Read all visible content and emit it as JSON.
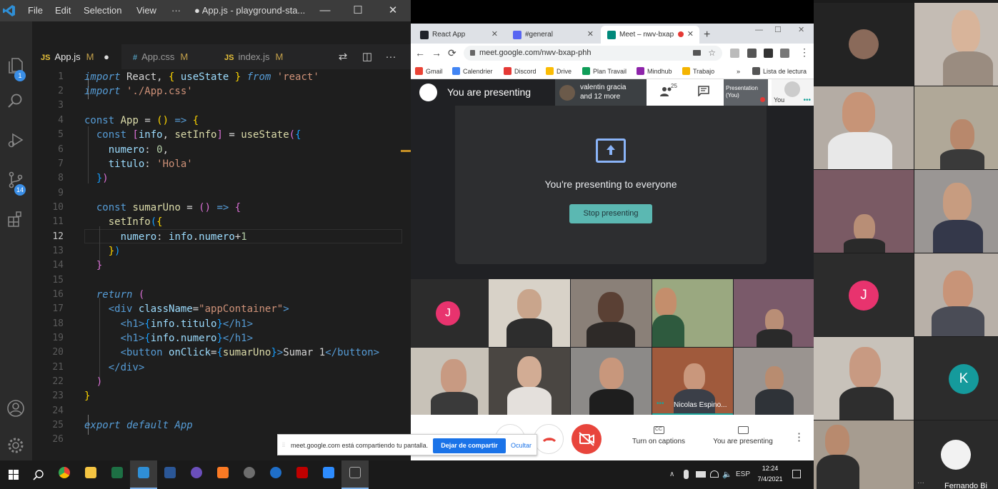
{
  "vscode": {
    "menu": [
      "File",
      "Edit",
      "Selection",
      "View",
      "···"
    ],
    "window_title": "● App.js - playground-sta...",
    "win_buttons": {
      "minimize": "—",
      "maximize": "☐",
      "close": "✕"
    },
    "activity_badges": {
      "explorer": "1",
      "source_control": "14"
    },
    "tabs": [
      {
        "icon": "JS",
        "name": "App.js",
        "status": "M",
        "dirty": "●"
      },
      {
        "icon": "#",
        "name": "App.css",
        "status": "M"
      },
      {
        "icon": "JS",
        "name": "index.js",
        "status": "M"
      }
    ],
    "tab_actions": [
      "⇄",
      "◫",
      "···"
    ],
    "current_line": 12,
    "line_numbers": [
      "1",
      "2",
      "3",
      "4",
      "5",
      "6",
      "7",
      "8",
      "9",
      "10",
      "11",
      "12",
      "13",
      "14",
      "15",
      "16",
      "17",
      "18",
      "19",
      "20",
      "21",
      "22",
      "23",
      "24",
      "25",
      "26"
    ],
    "code": {
      "l1": {
        "import": "import",
        "react": " React, ",
        "b1": "{",
        "useState": " useState ",
        "b2": "}",
        "from": " from ",
        "mod": "'react'"
      },
      "l2": {
        "import": "import",
        "mod": " './App.css'"
      },
      "l4": {
        "const": "const",
        "app": " App ",
        "eq": "= ",
        "p": "()",
        "arrow": " => ",
        "b": "{"
      },
      "l5": {
        "const": "const",
        "b1": " [",
        "info": "info",
        "comma": ", ",
        "setInfo": "setInfo",
        "b2": "]",
        "eq": " = ",
        "useState": "useState",
        "p": "(",
        "b3": "{"
      },
      "l6": {
        "key": "numero",
        "colon": ": ",
        "val": "0",
        "comma": ","
      },
      "l7": {
        "key": "titulo",
        "colon": ": ",
        "val": "'Hola'"
      },
      "l8": {
        "b": "}",
        "p": ")"
      },
      "l10": {
        "const": "const",
        "fn": " sumarUno",
        "eq": " = ",
        "p": "()",
        "arrow": " => ",
        "b": "{"
      },
      "l11": {
        "fn": "setInfo",
        "p": "(",
        "b": "{"
      },
      "l12": {
        "key": "numero",
        "colon": ": ",
        "obj": "info",
        "dot": ".",
        "prop": "numero",
        "plus": "+",
        "val": "1"
      },
      "l13": {
        "b": "}",
        "p": ")"
      },
      "l14": {
        "b": "}"
      },
      "l16": {
        "return": "return",
        "p": " ("
      },
      "l17": {
        "open": "<div",
        "attr": " className",
        "eq": "=",
        "val": "\"appContainer\"",
        "close": ">"
      },
      "l18": {
        "open": "<h1>",
        "b1": "{",
        "expr": "info.titulo",
        "b2": "}",
        "close": "</h1>"
      },
      "l19": {
        "open": "<h1>",
        "b1": "{",
        "expr": "info.numero",
        "b2": "}",
        "close": "</h1>"
      },
      "l20": {
        "open": "<button",
        "attr": " onClick",
        "eq": "=",
        "b1": "{",
        "fn": "sumarUno",
        "b2": "}",
        "gt": ">",
        "text": "Sumar 1",
        "close": "</button>"
      },
      "l21": {
        "close": "</div>"
      },
      "l22": {
        "p": ")"
      },
      "l23": {
        "b": "}"
      },
      "l25": {
        "export": "export default",
        "app": " App"
      }
    }
  },
  "chrome": {
    "tabs": [
      {
        "title": "React App",
        "close": "✕",
        "favicon_color": "#20232a"
      },
      {
        "title": "#general",
        "close": "✕",
        "favicon_color": "#5865f2"
      },
      {
        "title": "Meet – nwv-bxap",
        "close": "✕",
        "favicon_color": "#00897b",
        "active": true
      }
    ],
    "new_tab": "+",
    "window_buttons": [
      "—",
      "☐",
      "✕"
    ],
    "nav": [
      "←",
      "→",
      "⟳"
    ],
    "url": "meet.google.com/nwv-bxap-phh",
    "bookmarks": [
      "Gmail",
      "Calendrier",
      "Discord",
      "Drive",
      "Plan Travail",
      "Mindhub",
      "Trabajo",
      "»",
      "Lista de lectura"
    ],
    "bookmark_colors": [
      "#ea4335",
      "#4285f4",
      "#e53935",
      "#fbbc04",
      "#0f9d58",
      "#8e24aa",
      "#f4b400",
      "#333",
      "#555"
    ]
  },
  "meet": {
    "presenting_label": "You are presenting",
    "people_chip": {
      "line1": "valentin gracia",
      "line2": "and 12 more"
    },
    "participant_count": "25",
    "presentation_thumb": {
      "line1": "Presentation",
      "line2": "(You)"
    },
    "you_label": "You",
    "present_title": "You're presenting to everyone",
    "stop_button": "Stop presenting",
    "tile_names": {
      "nicolas": "Nicolas Espino..."
    },
    "avatar_letter_j": "J",
    "bottom": {
      "captions": "Turn on captions",
      "presenting": "You are presenting",
      "more": "⋮",
      "cc_icon": "CC"
    },
    "share_bar": {
      "text": "meet.google.com está compartiendo tu pantalla.",
      "stop": "Dejar de compartir",
      "hide": "Ocultar",
      "grip": "⦙⦙"
    }
  },
  "right_column": {
    "avatar_j": "J",
    "avatar_k": "K",
    "name_bottom": "Fernando Bi",
    "dots": "···"
  },
  "taskbar": {
    "tray_lang": "ESP",
    "time": "12:24",
    "date": "7/4/2021",
    "tray_up": "∧"
  },
  "colors": {
    "avatar_pink": "#e8336e",
    "avatar_teal": "#159a9c",
    "stop_btn": "#5bb8b2",
    "end_call": "#e8453c",
    "vs_badge": "#3a8ee6"
  }
}
